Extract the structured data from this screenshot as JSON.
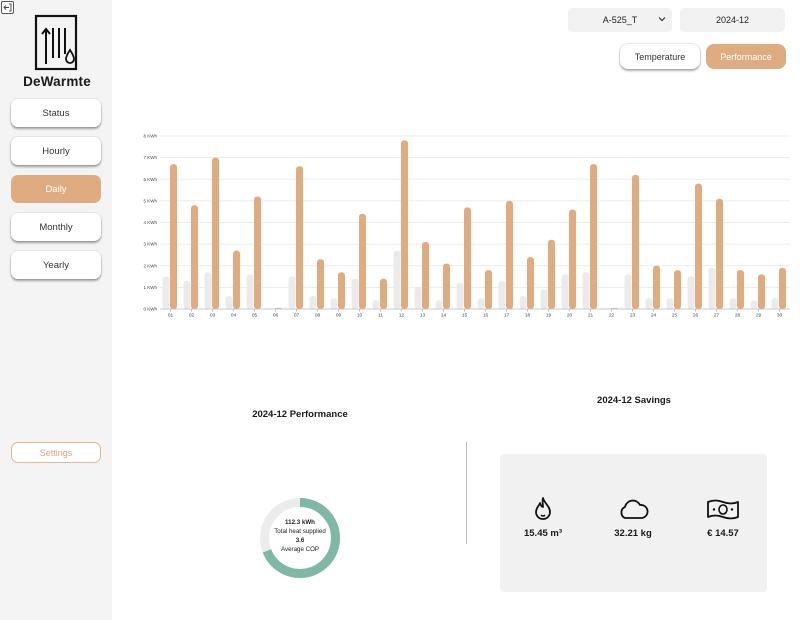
{
  "app": {
    "name": "DeWarmte"
  },
  "sidebar": {
    "items": [
      {
        "label": "Status",
        "active": false
      },
      {
        "label": "Hourly",
        "active": false
      },
      {
        "label": "Daily",
        "active": true
      },
      {
        "label": "Monthly",
        "active": false
      },
      {
        "label": "Yearly",
        "active": false
      }
    ],
    "settings_label": "Settings"
  },
  "controls": {
    "device": "A-525_T",
    "month": "2024-12",
    "tabs": [
      {
        "label": "Temperature",
        "active": false
      },
      {
        "label": "Performance",
        "active": true
      }
    ]
  },
  "colors": {
    "accent": "#dfac82",
    "light_bar": "#ebebeb",
    "donut": "#7fb8a6"
  },
  "chart_data": {
    "type": "bar",
    "categories": [
      "01",
      "02",
      "03",
      "04",
      "05",
      "06",
      "07",
      "08",
      "09",
      "10",
      "11",
      "12",
      "13",
      "14",
      "15",
      "16",
      "17",
      "18",
      "19",
      "20",
      "21",
      "22",
      "23",
      "24",
      "25",
      "26",
      "27",
      "28",
      "29",
      "30"
    ],
    "series": [
      {
        "values": [
          1.5,
          1.3,
          1.7,
          0.6,
          1.6,
          0.0,
          1.5,
          0.6,
          0.5,
          1.4,
          0.4,
          2.7,
          1.0,
          0.4,
          1.2,
          0.5,
          1.3,
          0.6,
          0.9,
          1.6,
          1.7,
          0.0,
          1.6,
          0.5,
          0.5,
          1.5,
          1.9,
          0.5,
          0.4,
          0.5
        ]
      },
      {
        "values": [
          6.7,
          4.8,
          7.0,
          2.7,
          5.2,
          0.05,
          6.6,
          2.3,
          1.7,
          4.4,
          1.4,
          7.8,
          3.1,
          2.1,
          4.7,
          1.8,
          5.0,
          2.4,
          3.2,
          4.6,
          6.7,
          0.05,
          6.2,
          2.0,
          1.8,
          5.8,
          5.1,
          1.8,
          1.6,
          1.9
        ]
      }
    ],
    "yticks": [
      "0 KWh",
      "1 KWh",
      "2 KWh",
      "3 KWh",
      "4 KWh",
      "5 KWh",
      "6 KWh",
      "7 KWh",
      "8 KWh"
    ],
    "ylim": [
      0,
      8
    ],
    "grid": true
  },
  "performance": {
    "title": "2024-12 Performance",
    "total_heat": "112.3 kWh",
    "total_heat_label": "Total heat supplied",
    "cop": "3.6",
    "cop_label": "Average COP",
    "ring_fill_fraction": 0.69
  },
  "savings": {
    "title": "2024-12 Savings",
    "items": [
      {
        "icon": "flame-icon",
        "value": "15.45 m³"
      },
      {
        "icon": "cloud-icon",
        "value": "32.21 kg"
      },
      {
        "icon": "banknote-icon",
        "value": "€ 14.57"
      }
    ]
  }
}
